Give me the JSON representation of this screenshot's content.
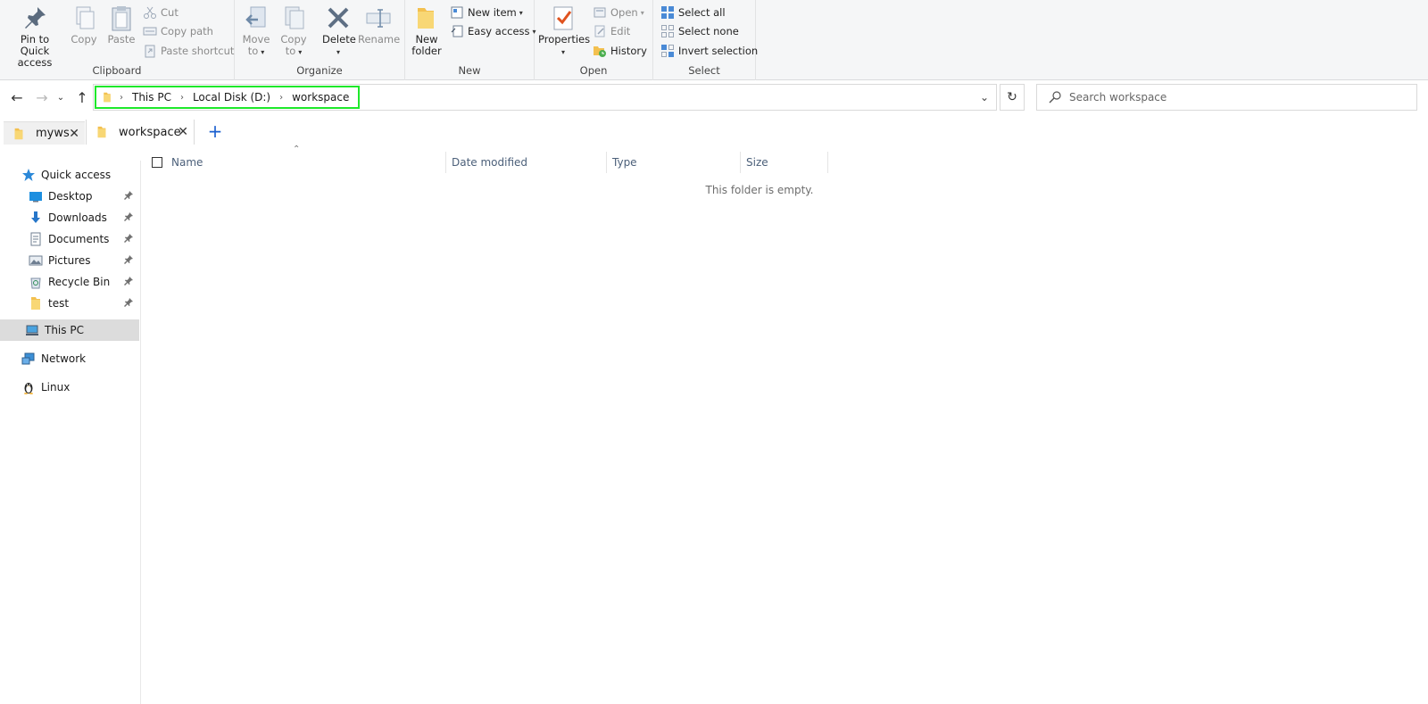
{
  "ribbon": {
    "clipboard": {
      "label": "Clipboard",
      "pin_label_1": "Pin to Quick",
      "pin_label_2": "access",
      "copy_label": "Copy",
      "paste_label": "Paste",
      "cut_label": "Cut",
      "copy_path_label": "Copy path",
      "paste_shortcut_label": "Paste shortcut"
    },
    "organize": {
      "label": "Organize",
      "move_to_1": "Move",
      "move_to_2": "to",
      "copy_to_1": "Copy",
      "copy_to_2": "to",
      "delete_label": "Delete",
      "rename_label": "Rename"
    },
    "new": {
      "label": "New",
      "new_folder_1": "New",
      "new_folder_2": "folder",
      "new_item_label": "New item",
      "easy_access_label": "Easy access"
    },
    "open": {
      "label": "Open",
      "properties_label": "Properties",
      "open_label": "Open",
      "edit_label": "Edit",
      "history_label": "History"
    },
    "select": {
      "label": "Select",
      "select_all_label": "Select all",
      "select_none_label": "Select none",
      "invert_selection_label": "Invert selection"
    }
  },
  "address": {
    "crumbs": [
      "This PC",
      "Local Disk (D:)",
      "workspace"
    ],
    "highlight_color": "#1ee82a"
  },
  "search": {
    "placeholder": "Search workspace"
  },
  "tabs": [
    {
      "label": "myws",
      "active": false
    },
    {
      "label": "workspace",
      "active": true
    }
  ],
  "sidebar": {
    "quick_access": "Quick access",
    "items": [
      {
        "label": "Desktop",
        "pinned": true
      },
      {
        "label": "Downloads",
        "pinned": true
      },
      {
        "label": "Documents",
        "pinned": true
      },
      {
        "label": "Pictures",
        "pinned": true
      },
      {
        "label": "Recycle Bin",
        "pinned": true
      },
      {
        "label": "test",
        "pinned": true
      }
    ],
    "this_pc": "This PC",
    "network": "Network",
    "linux": "Linux"
  },
  "content": {
    "columns": [
      "Name",
      "Date modified",
      "Type",
      "Size"
    ],
    "empty_message": "This folder is empty."
  }
}
